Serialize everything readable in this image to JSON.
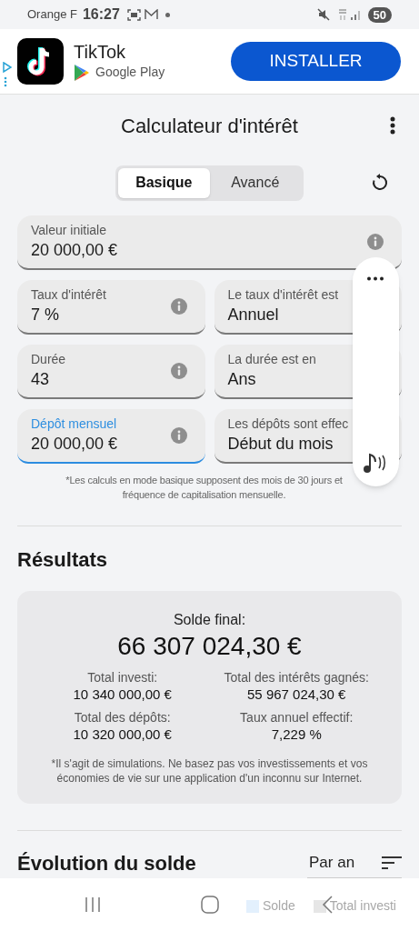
{
  "status_bar": {
    "carrier": "Orange F",
    "time": "16:27",
    "battery": "50"
  },
  "ad": {
    "app_name": "TikTok",
    "store": "Google Play",
    "button": "INSTALLER"
  },
  "header": {
    "title": "Calculateur d'intérêt"
  },
  "tabs": [
    {
      "label": "Basique",
      "selected": true
    },
    {
      "label": "Avancé",
      "selected": false
    }
  ],
  "initial": {
    "kind": "input",
    "label": "Valeur initiale",
    "value": "20 000,00 €",
    "focused": false
  },
  "fields": [
    {
      "kind": "input",
      "label": "Taux d'intérêt",
      "value": "7 %",
      "focused": false
    },
    {
      "kind": "select",
      "label": "Le taux d'intérêt est",
      "value": "Annuel",
      "focused": false
    },
    {
      "kind": "input",
      "label": "Durée",
      "value": "43",
      "focused": false
    },
    {
      "kind": "select",
      "label": "La durée est en",
      "value": "Ans",
      "focused": false
    },
    {
      "kind": "input",
      "label": "Dépôt mensuel",
      "value": "20 000,00 €",
      "focused": true
    },
    {
      "kind": "select",
      "label": "Les dépôts sont effec",
      "value": "Début du mois",
      "focused": false
    }
  ],
  "note": [
    "*Les calculs en mode basique supposent des mois de 30 jours et",
    "fréquence de capitalisation mensuelle."
  ],
  "results": {
    "title": "Résultats",
    "final_label": "Solde final:",
    "final_value": "66 307 024,30 €",
    "stats": [
      {
        "label": "Total investi:",
        "value": "10 340 000,00 €"
      },
      {
        "label": "Total des intérêts gagnés:",
        "value": "55 967 024,30 €"
      },
      {
        "label": "Total des dépôts:",
        "value": "10 320 000,00 €"
      },
      {
        "label": "Taux annuel effectif:",
        "value": "7,229 %"
      }
    ],
    "disclaimer": "*Il s'agit de simulations. Ne basez pas vos investissements et vos économies de vie sur une application d'un inconnu sur Internet."
  },
  "evolution": {
    "title": "Évolution du solde",
    "period": "Par an",
    "legend": [
      {
        "label": "Solde",
        "color": "#e3f0fd"
      },
      {
        "label": "Total investi",
        "color": "#e6e6e6"
      }
    ]
  }
}
